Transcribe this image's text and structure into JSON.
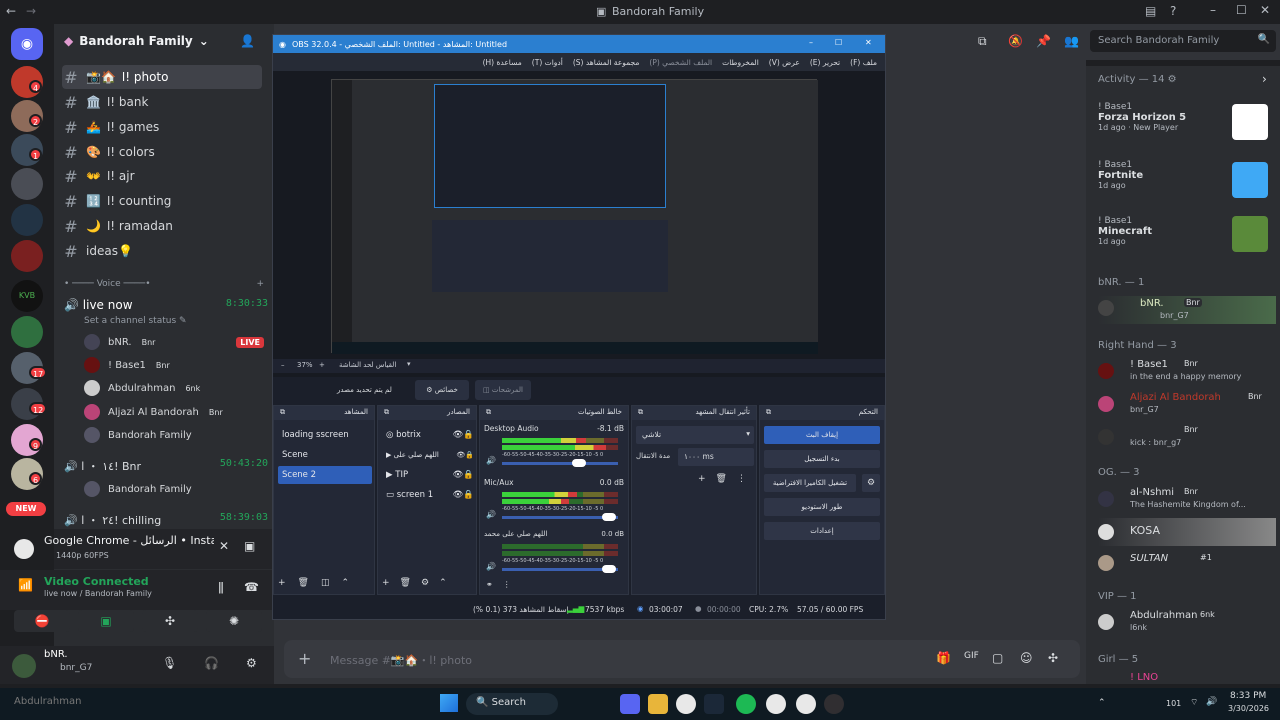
{
  "window": {
    "title": "Bandorah Family"
  },
  "search": {
    "placeholder": "Search Bandorah Family"
  },
  "server": {
    "name": "Bandorah Family"
  },
  "guild_badges": [
    "4",
    "2",
    "1",
    "17",
    "12",
    "9",
    "6"
  ],
  "new_badge": "NEW",
  "channels": [
    {
      "icon": "📸🏠",
      "name": "ا! photo"
    },
    {
      "icon": "🏛️",
      "name": "ا! bank"
    },
    {
      "icon": "🚣",
      "name": "ا! games"
    },
    {
      "icon": "🎨",
      "name": "ا! colors"
    },
    {
      "icon": "👐",
      "name": "ا! ajr"
    },
    {
      "icon": "🔢",
      "name": "ا! counting"
    },
    {
      "icon": "🌙",
      "name": "ا! ramadan"
    },
    {
      "icon": "",
      "name": "ideas💡"
    }
  ],
  "voice_category": "Voice",
  "voice_channel": {
    "name": "live now",
    "time": "8:30:33",
    "status": "Set a channel status"
  },
  "live_badge": "LIVE",
  "voice_users": [
    {
      "name": "bNR.",
      "tag": "Bnr"
    },
    {
      "name": "! Base1",
      "tag": "Bnr"
    },
    {
      "name": "Abdulrahman",
      "tag": "6nk"
    },
    {
      "name": "Aljazi Al Bandorah",
      "tag": "Bnr"
    },
    {
      "name": "Bandorah Family",
      "tag": ""
    }
  ],
  "voice_channel_2": {
    "name": "١٤ ・ ا! Bnr",
    "time": "50:43:20",
    "user": "Bandorah Family"
  },
  "voice_channel_3": {
    "name": "٢٤ ・ ا! chilling",
    "time": "58:39:03"
  },
  "activity_card": {
    "title": "Google Chrome - الرسائل • Instag...",
    "sub": "1440p 60FPS"
  },
  "voice_conn": {
    "title": "Video Connected",
    "sub": "live now / Bandorah Family"
  },
  "user_panel": {
    "name": "bNR.",
    "tag": "bnr_G7"
  },
  "chat_placeholder": "Message #📸🏠・ا! photo",
  "activity": {
    "title": "Activity — 14",
    "items": [
      {
        "user": "! Base1",
        "game": "Forza Horizon 5",
        "meta": "1d ago",
        "extra": "New Player"
      },
      {
        "user": "! Base1",
        "game": "Fortnite",
        "meta": "1d ago",
        "extra": ""
      },
      {
        "user": "! Base1",
        "game": "Minecraft",
        "meta": "1d ago",
        "extra": ""
      }
    ]
  },
  "member_groups": [
    {
      "title": "bNR. — 1",
      "members": [
        {
          "name": "bNR.",
          "tag": "Bnr",
          "sub": "bnr_G7"
        }
      ]
    },
    {
      "title": "Right Hand — 3",
      "members": [
        {
          "name": "! Base1",
          "tag": "Bnr",
          "sub": "in the end a happy memory"
        },
        {
          "name": "Aljazi Al Bandorah",
          "tag": "Bnr",
          "sub": "bnr_G7"
        },
        {
          "name": "",
          "tag": "Bnr",
          "sub": "kick : bnr_g7"
        }
      ]
    },
    {
      "title": "OG. — 3",
      "members": [
        {
          "name": "al-Nshmi",
          "tag": "Bnr",
          "sub": "The Hashemite Kingdom of..."
        },
        {
          "name": "KOSA",
          "tag": "",
          "sub": ""
        },
        {
          "name": "SULTAN",
          "tag": "#1",
          "sub": ""
        }
      ]
    },
    {
      "title": "VIP — 1",
      "members": [
        {
          "name": "Abdulrahman",
          "tag": "6nk",
          "sub": "l6nk"
        }
      ]
    },
    {
      "title": "Girl — 5",
      "members": [
        {
          "name": "! LNO",
          "tag": "",
          "sub": ""
        }
      ]
    }
  ],
  "obs": {
    "title": "OBS 32.0.4 - الملف الشخصي: Untitled - المشاهد: Untitled",
    "menu": [
      "ملف (F)",
      "تحرير (E)",
      "عرض (V)",
      "المخروطات",
      "الملف الشخصي (P)",
      "مجموعة المشاهد (S)",
      "أدوات (T)",
      "مساعدة (H)"
    ],
    "zoom": "37%",
    "zoom_label": "القياس لحد الشاشة",
    "no_source": "لم يتم تحديد مصدر",
    "properties_btn": "خصائص",
    "filters_btn": "المرشحات",
    "docks": {
      "scenes": "المشاهد",
      "sources": "المصادر",
      "mixer": "خالط الصوتيات",
      "transitions": "تأثير انتقال المشهد",
      "controls": "التحكم"
    },
    "scenes": [
      "loading sscreen",
      "Scene",
      "Scene 2"
    ],
    "sources": [
      "botrix",
      "اللهم صلي على",
      "TIP",
      "screen 1"
    ],
    "mixer": [
      {
        "name": "Desktop Audio",
        "db": "-8.1 dB"
      },
      {
        "name": "Mic/Aux",
        "db": "0.0 dB"
      },
      {
        "name": "اللهم صلي على محمد",
        "db": "0.0 dB"
      }
    ],
    "meter_scale": "-60-55-50-45-40-35-30-25-20-15-10 -5 0",
    "transition": {
      "type": "تلاشي",
      "duration_label": "مدة الانتقال",
      "duration": "١٠٠٠ ms"
    },
    "controls": [
      "إيقاف البث",
      "بدء التسجيل",
      "تشغيل الكاميرا الافتراضية",
      "طور الاستوديو",
      "إعدادات"
    ],
    "status": {
      "dropped": "إسقاط المشاهد 373 (0.1 %)",
      "kbps": "7537 kbps",
      "live": "03:00:07",
      "rec": "00:00:00",
      "cpu": "CPU: 2.7%",
      "fps": "57.05 / 60.00 FPS"
    }
  },
  "taskbar": {
    "search": "Search",
    "temp": "101",
    "time": "8:33 PM",
    "date": "3/30/2026",
    "watermark": "Abdulrahman"
  }
}
